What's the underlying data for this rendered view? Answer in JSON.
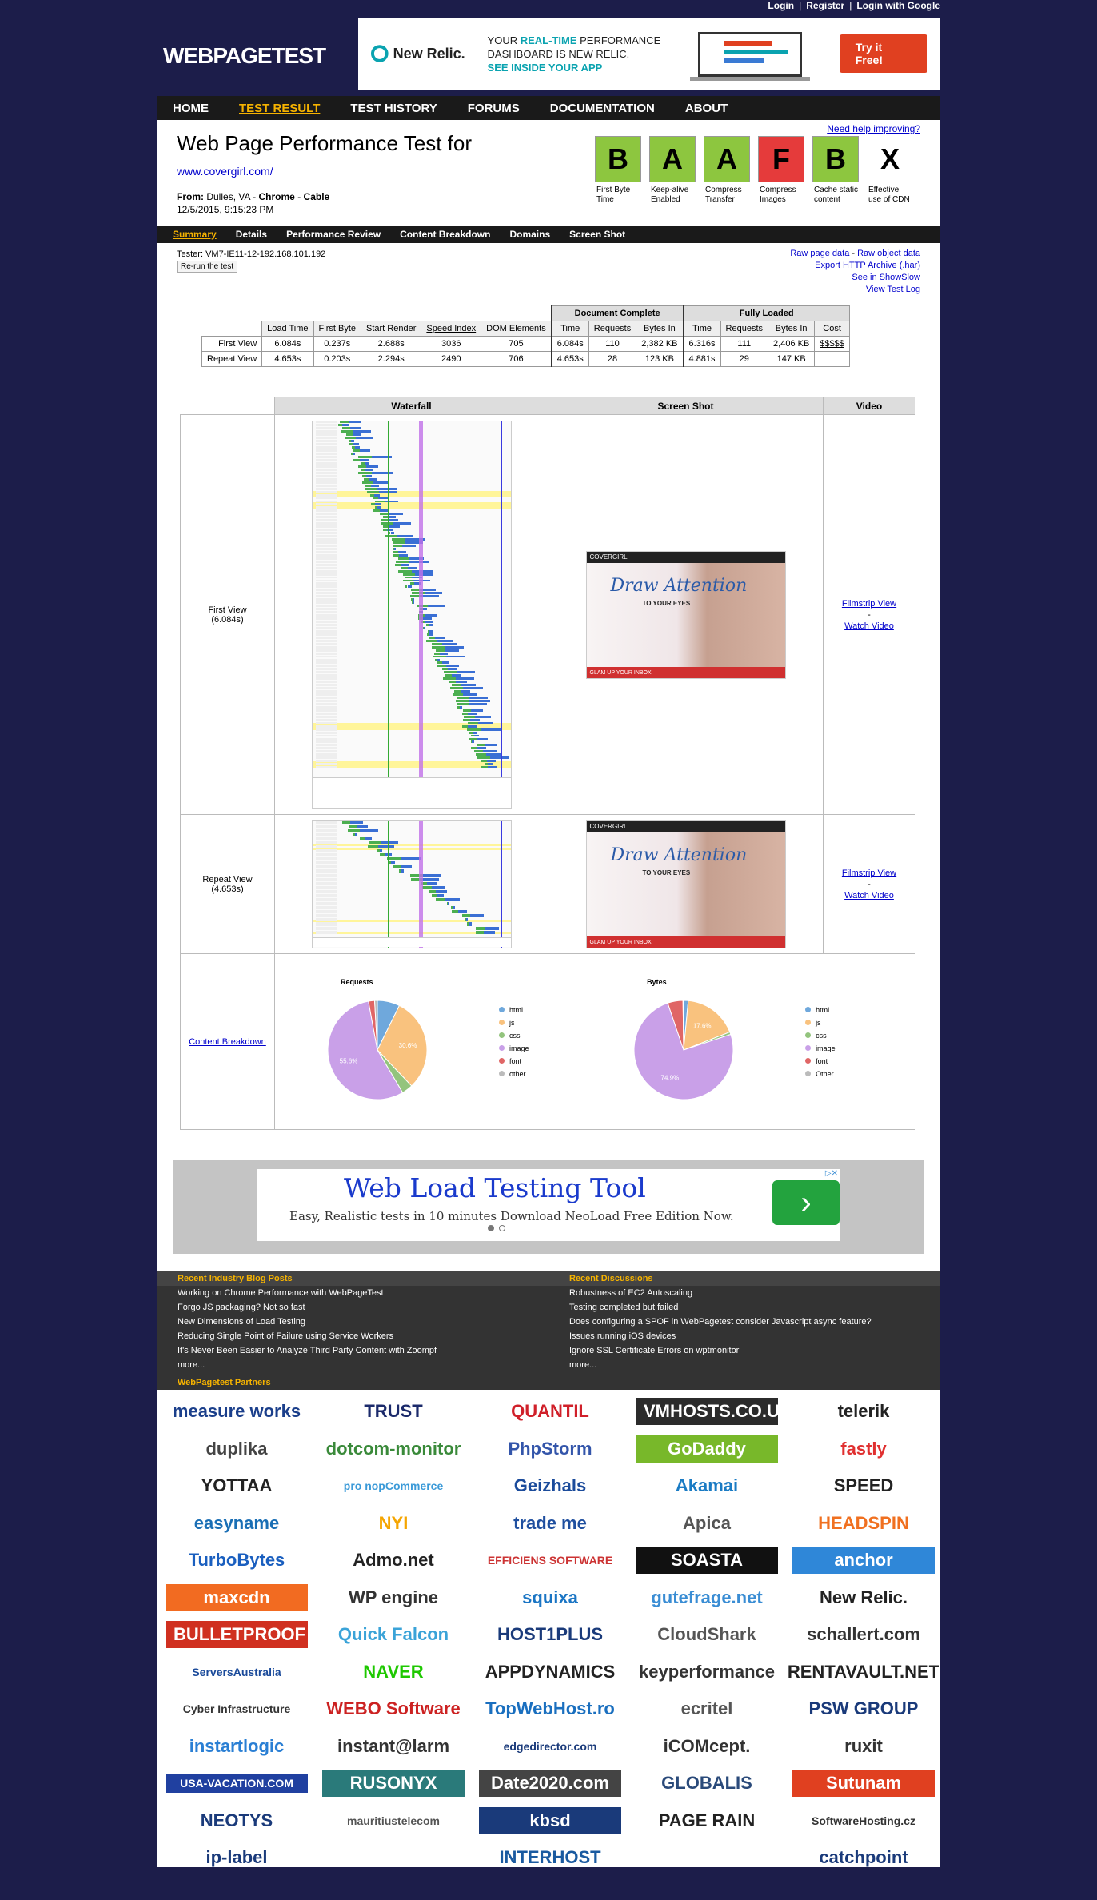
{
  "top_links": [
    "Login",
    "Register",
    "Login with Google"
  ],
  "logo": "WEBPAGETEST",
  "top_ad": {
    "brand": "New Relic.",
    "text1a": "YOUR",
    "text1b": "REAL-TIME",
    "text1c": "PERFORMANCE",
    "text2": "DASHBOARD IS NEW RELIC.",
    "text3": "SEE INSIDE YOUR APP",
    "cta": "Try it Free!"
  },
  "nav": [
    "HOME",
    "TEST RESULT",
    "TEST HISTORY",
    "FORUMS",
    "DOCUMENTATION",
    "ABOUT"
  ],
  "nav_active": 1,
  "result": {
    "title": "Web Page Performance Test for",
    "url": "www.covergirl.com/",
    "from_label": "From:",
    "from_loc": "Dulles, VA -",
    "browser": "Chrome",
    "sep": "-",
    "conn": "Cable",
    "date": "12/5/2015, 9:15:23 PM",
    "help": "Need help improving?"
  },
  "grades": [
    {
      "grade": "B",
      "label": "First Byte Time",
      "color": "#8dc63f"
    },
    {
      "grade": "A",
      "label": "Keep-alive Enabled",
      "color": "#8dc63f"
    },
    {
      "grade": "A",
      "label": "Compress Transfer",
      "color": "#8dc63f"
    },
    {
      "grade": "F",
      "label": "Compress Images",
      "color": "#e53b3b"
    },
    {
      "grade": "B",
      "label": "Cache static content",
      "color": "#8dc63f"
    },
    {
      "grade": "X",
      "label": "Effective use of CDN",
      "color": "#ffffff"
    }
  ],
  "subnav": [
    "Summary",
    "Details",
    "Performance Review",
    "Content Breakdown",
    "Domains",
    "Screen Shot"
  ],
  "tester": "Tester: VM7-IE11-12-192.168.101.192",
  "rerun": "Re-run the test",
  "raw_links": [
    "Raw page data",
    "-",
    "Raw object data",
    "Export HTTP Archive (.har)",
    "See in ShowSlow",
    "View Test Log"
  ],
  "table": {
    "group_doc": "Document Complete",
    "group_full": "Fully Loaded",
    "headers": [
      "Load Time",
      "First Byte",
      "Start Render",
      "Speed Index",
      "DOM Elements",
      "Time",
      "Requests",
      "Bytes In",
      "Time",
      "Requests",
      "Bytes In",
      "Cost"
    ],
    "rows": [
      {
        "label": "First View",
        "cells": [
          "6.084s",
          "0.237s",
          "2.688s",
          "3036",
          "705",
          "6.084s",
          "110",
          "2,382 KB",
          "6.316s",
          "111",
          "2,406 KB",
          "$$$$$"
        ]
      },
      {
        "label": "Repeat View",
        "cells": [
          "4.653s",
          "0.203s",
          "2.294s",
          "2490",
          "706",
          "4.653s",
          "28",
          "123 KB",
          "4.881s",
          "29",
          "147 KB",
          ""
        ]
      }
    ]
  },
  "media": {
    "headers": [
      "Waterfall",
      "Screen Shot",
      "Video"
    ],
    "first_view": "First View",
    "first_time": "(6.084s)",
    "repeat_view": "Repeat View",
    "repeat_time": "(4.653s)",
    "filmstrip": "Filmstrip View",
    "dash": "-",
    "watch": "Watch Video",
    "content_breakdown": "Content Breakdown",
    "shot_brand": "COVERGIRL",
    "shot_headline": "Draw Attention",
    "shot_sub": "TO YOUR EYES",
    "shot_banner": "GLAM UP YOUR INBOX!"
  },
  "chart_data": [
    {
      "type": "pie",
      "title": "Requests",
      "labels": [
        "html",
        "js",
        "css",
        "image",
        "font",
        "other"
      ],
      "values": [
        7.3,
        30.6,
        3.6,
        55.6,
        2.0,
        0.9
      ],
      "slice_labels": [
        "",
        "30.6%",
        "",
        "55.6%",
        "",
        ""
      ],
      "colors": [
        "#6fa8dc",
        "#f9c27e",
        "#93c47d",
        "#c9a0e8",
        "#e06666",
        "#bbbbbb"
      ]
    },
    {
      "type": "pie",
      "title": "Bytes",
      "labels": [
        "html",
        "js",
        "css",
        "image",
        "font",
        "other"
      ],
      "values": [
        1.5,
        17.6,
        0.8,
        74.9,
        5.0,
        0.2
      ],
      "slice_labels": [
        "",
        "17.6%",
        "",
        "74.9%",
        "",
        ""
      ],
      "colors": [
        "#6fa8dc",
        "#f9c27e",
        "#93c47d",
        "#c9a0e8",
        "#e06666",
        "#bbbbbb"
      ]
    }
  ],
  "legend_labels": [
    "html",
    "js",
    "css",
    "image",
    "font",
    "other"
  ],
  "legend_labels_bytes": [
    "html",
    "js",
    "css",
    "image",
    "font",
    "Other"
  ],
  "mid_ad": {
    "title": "Web Load Testing Tool",
    "desc": "Easy, Realistic tests in 10 minutes Download NeoLoad Free Edition Now.",
    "arrow": "›"
  },
  "blog": {
    "head_left": "Recent Industry Blog Posts",
    "head_right": "Recent Discussions",
    "left": [
      "Working on Chrome Performance with WebPageTest",
      "Forgo JS packaging? Not so fast",
      "New Dimensions of Load Testing",
      "Reducing Single Point of Failure using Service Workers",
      "It's Never Been Easier to Analyze Third Party Content with Zoompf",
      "more..."
    ],
    "right": [
      "Robustness of EC2 Autoscaling",
      "Testing completed but failed",
      "Does configuring a SPOF in WebPagetest consider Javascript async feature?",
      "Issues running iOS devices",
      "Ignore SSL Certificate Errors on wptmonitor",
      "more..."
    ]
  },
  "partners_head": "WebPagetest Partners",
  "partners": [
    {
      "name": "measure works",
      "color": "#1b3f8b"
    },
    {
      "name": "TRUST",
      "color": "#1b2a6b"
    },
    {
      "name": "QUANTIL",
      "color": "#d0202a"
    },
    {
      "name": "VMHOSTS.CO.UK",
      "color": "#ffffff",
      "bg": "#2b2b2b"
    },
    {
      "name": "telerik",
      "color": "#222222"
    },
    {
      "name": "duplika",
      "color": "#444444"
    },
    {
      "name": "dotcom-monitor",
      "color": "#3a8a3a"
    },
    {
      "name": "PhpStorm",
      "color": "#3355aa"
    },
    {
      "name": "GoDaddy",
      "color": "#ffffff",
      "bg": "#78b82a"
    },
    {
      "name": "fastly",
      "color": "#e03030"
    },
    {
      "name": "YOTTAA",
      "color": "#222222"
    },
    {
      "name": "pro nopCommerce",
      "color": "#3b9ad8"
    },
    {
      "name": "Geizhals",
      "color": "#1b4b9b"
    },
    {
      "name": "Akamai",
      "color": "#1a7bc4"
    },
    {
      "name": "SPEED",
      "color": "#222222"
    },
    {
      "name": "easyname",
      "color": "#1a6fb5"
    },
    {
      "name": "NYI",
      "color": "#f5a500"
    },
    {
      "name": "trade me",
      "color": "#1f4f9f"
    },
    {
      "name": "Apica",
      "color": "#555555"
    },
    {
      "name": "HEADSPIN",
      "color": "#f07020"
    },
    {
      "name": "TurboBytes",
      "color": "#1a5fbf"
    },
    {
      "name": "Admo.net",
      "color": "#222222"
    },
    {
      "name": "EFFICIENS SOFTWARE",
      "color": "#cc3333"
    },
    {
      "name": "SOASTA",
      "color": "#ffffff",
      "bg": "#111111"
    },
    {
      "name": "anchor",
      "color": "#ffffff",
      "bg": "#2f87d8"
    },
    {
      "name": "maxcdn",
      "color": "#ffffff",
      "bg": "#f26b21"
    },
    {
      "name": "WP engine",
      "color": "#333333"
    },
    {
      "name": "squixa",
      "color": "#1a75c4"
    },
    {
      "name": "gutefrage.net",
      "color": "#3a8dd4"
    },
    {
      "name": "New Relic.",
      "color": "#222222"
    },
    {
      "name": "BULLETPROOF",
      "color": "#ffffff",
      "bg": "#d03020"
    },
    {
      "name": "Quick Falcon",
      "color": "#3aa3d8"
    },
    {
      "name": "HOST1PLUS",
      "color": "#1a3a7a"
    },
    {
      "name": "CloudShark",
      "color": "#555555"
    },
    {
      "name": "schallert.com",
      "color": "#333333"
    },
    {
      "name": "ServersAustralia",
      "color": "#1a4a9a"
    },
    {
      "name": "NAVER",
      "color": "#1ec800"
    },
    {
      "name": "APPDYNAMICS",
      "color": "#222222"
    },
    {
      "name": "keyperformance",
      "color": "#333333"
    },
    {
      "name": "RENTAVAULT.NET",
      "color": "#222222"
    },
    {
      "name": "Cyber Infrastructure",
      "color": "#333333"
    },
    {
      "name": "WEBO Software",
      "color": "#cc2222"
    },
    {
      "name": "TopWebHost.ro",
      "color": "#1a6fbf"
    },
    {
      "name": "ecritel",
      "color": "#555555"
    },
    {
      "name": "PSW GROUP",
      "color": "#1a3a7a"
    },
    {
      "name": "instartlogic",
      "color": "#2a7fd4"
    },
    {
      "name": "instant@larm",
      "color": "#333333"
    },
    {
      "name": "edgedirector.com",
      "color": "#1a3a7a"
    },
    {
      "name": "iCOMcept.",
      "color": "#333333"
    },
    {
      "name": "ruxit",
      "color": "#333333"
    },
    {
      "name": "USA-VACATION.COM",
      "color": "#ffffff",
      "bg": "#2040a0"
    },
    {
      "name": "RUSONYX",
      "color": "#ffffff",
      "bg": "#2a7a7a"
    },
    {
      "name": "Date2020.com",
      "color": "#ffffff",
      "bg": "#444444"
    },
    {
      "name": "GLOBALIS",
      "color": "#2a4a7a"
    },
    {
      "name": "Sutunam",
      "color": "#ffffff",
      "bg": "#e04020"
    },
    {
      "name": "NEOTYS",
      "color": "#1a3a7a"
    },
    {
      "name": "mauritiustelecom",
      "color": "#555555"
    },
    {
      "name": "kbsd",
      "color": "#ffffff",
      "bg": "#1a3a7a"
    },
    {
      "name": "PAGE RAIN",
      "color": "#222222"
    },
    {
      "name": "SoftwareHosting.cz",
      "color": "#333333"
    },
    {
      "name": "ip-label",
      "color": "#1a3a7a"
    },
    {
      "name": "",
      "color": "#ffffff"
    },
    {
      "name": "INTERHOST",
      "color": "#1a5aa0"
    },
    {
      "name": "",
      "color": "#ffffff"
    },
    {
      "name": "catchpoint",
      "color": "#1a3a7a"
    }
  ]
}
